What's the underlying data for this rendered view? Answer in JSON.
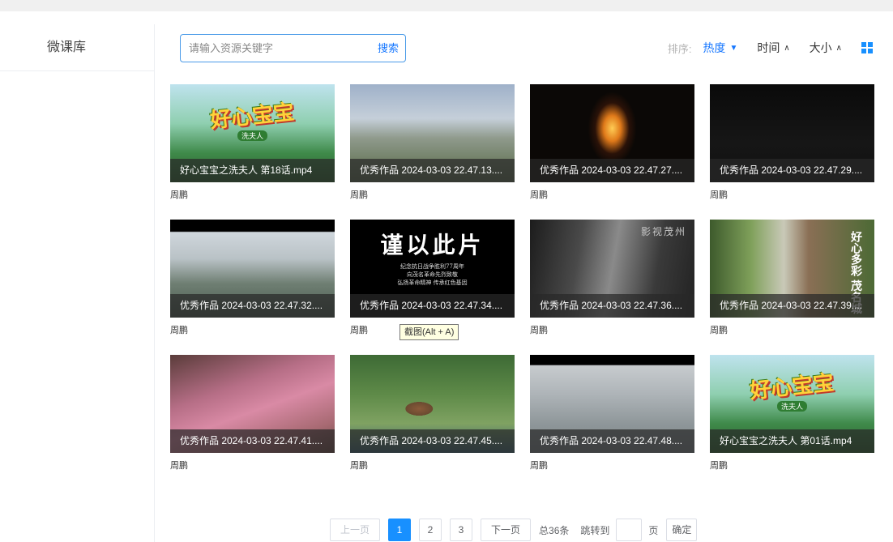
{
  "sidebar": {
    "title": "微课库"
  },
  "search": {
    "placeholder": "请输入资源关键字",
    "button_label": "搜索"
  },
  "sort": {
    "label": "排序:",
    "options": [
      {
        "label": "热度",
        "direction": "desc",
        "active": true
      },
      {
        "label": "时间",
        "direction": "asc",
        "active": false
      },
      {
        "label": "大小",
        "direction": "asc",
        "active": false
      }
    ],
    "view_icon": "grid-view-icon"
  },
  "videos": [
    {
      "title": "好心宝宝之洗夫人 第18话.mp4",
      "author": "周鹏",
      "thumb": "cartoon-logo-mountains"
    },
    {
      "title": "优秀作品 2024-03-03 22.47.13....",
      "author": "周鹏",
      "thumb": "city-aerial"
    },
    {
      "title": "优秀作品 2024-03-03 22.47.27....",
      "author": "周鹏",
      "thumb": "candle"
    },
    {
      "title": "优秀作品 2024-03-03 22.47.29....",
      "author": "周鹏",
      "thumb": "black"
    },
    {
      "title": "优秀作品 2024-03-03 22.47.32....",
      "author": "周鹏",
      "thumb": "misty-mountains"
    },
    {
      "title": "优秀作品 2024-03-03 22.47.34....",
      "author": "周鹏",
      "thumb": "memorial-text"
    },
    {
      "title": "优秀作品 2024-03-03 22.47.36....",
      "author": "周鹏",
      "thumb": "salute-bw"
    },
    {
      "title": "优秀作品 2024-03-03 22.47.39....",
      "author": "周鹏",
      "thumb": "street-poem"
    },
    {
      "title": "优秀作品 2024-03-03 22.47.41....",
      "author": "周鹏",
      "thumb": "pink-fields"
    },
    {
      "title": "优秀作品 2024-03-03 22.47.45....",
      "author": "周鹏",
      "thumb": "monument-park"
    },
    {
      "title": "优秀作品 2024-03-03 22.47.48....",
      "author": "周鹏",
      "thumb": "foggy-city"
    },
    {
      "title": "好心宝宝之洗夫人 第01话.mp4",
      "author": "周鹏",
      "thumb": "cartoon-logo-mountains"
    }
  ],
  "thumb_text": {
    "logo": "好心宝宝",
    "logo_sub": "洗夫人",
    "memorial_title": "谨以此片",
    "memorial_lines": [
      "纪念抗日战争胜利77周年",
      "向茂名革命先烈致敬",
      "弘扬革命精神 传承红色基因"
    ],
    "stamp": "影视茂州",
    "poem": "好心多彩 茂名城"
  },
  "tooltip": "截图(Alt + A)",
  "pagination": {
    "prev": "上一页",
    "pages": [
      "1",
      "2",
      "3"
    ],
    "current": "1",
    "next": "下一页",
    "total": "总36条",
    "jump_label": "跳转到",
    "page_unit": "页",
    "confirm": "确定"
  }
}
